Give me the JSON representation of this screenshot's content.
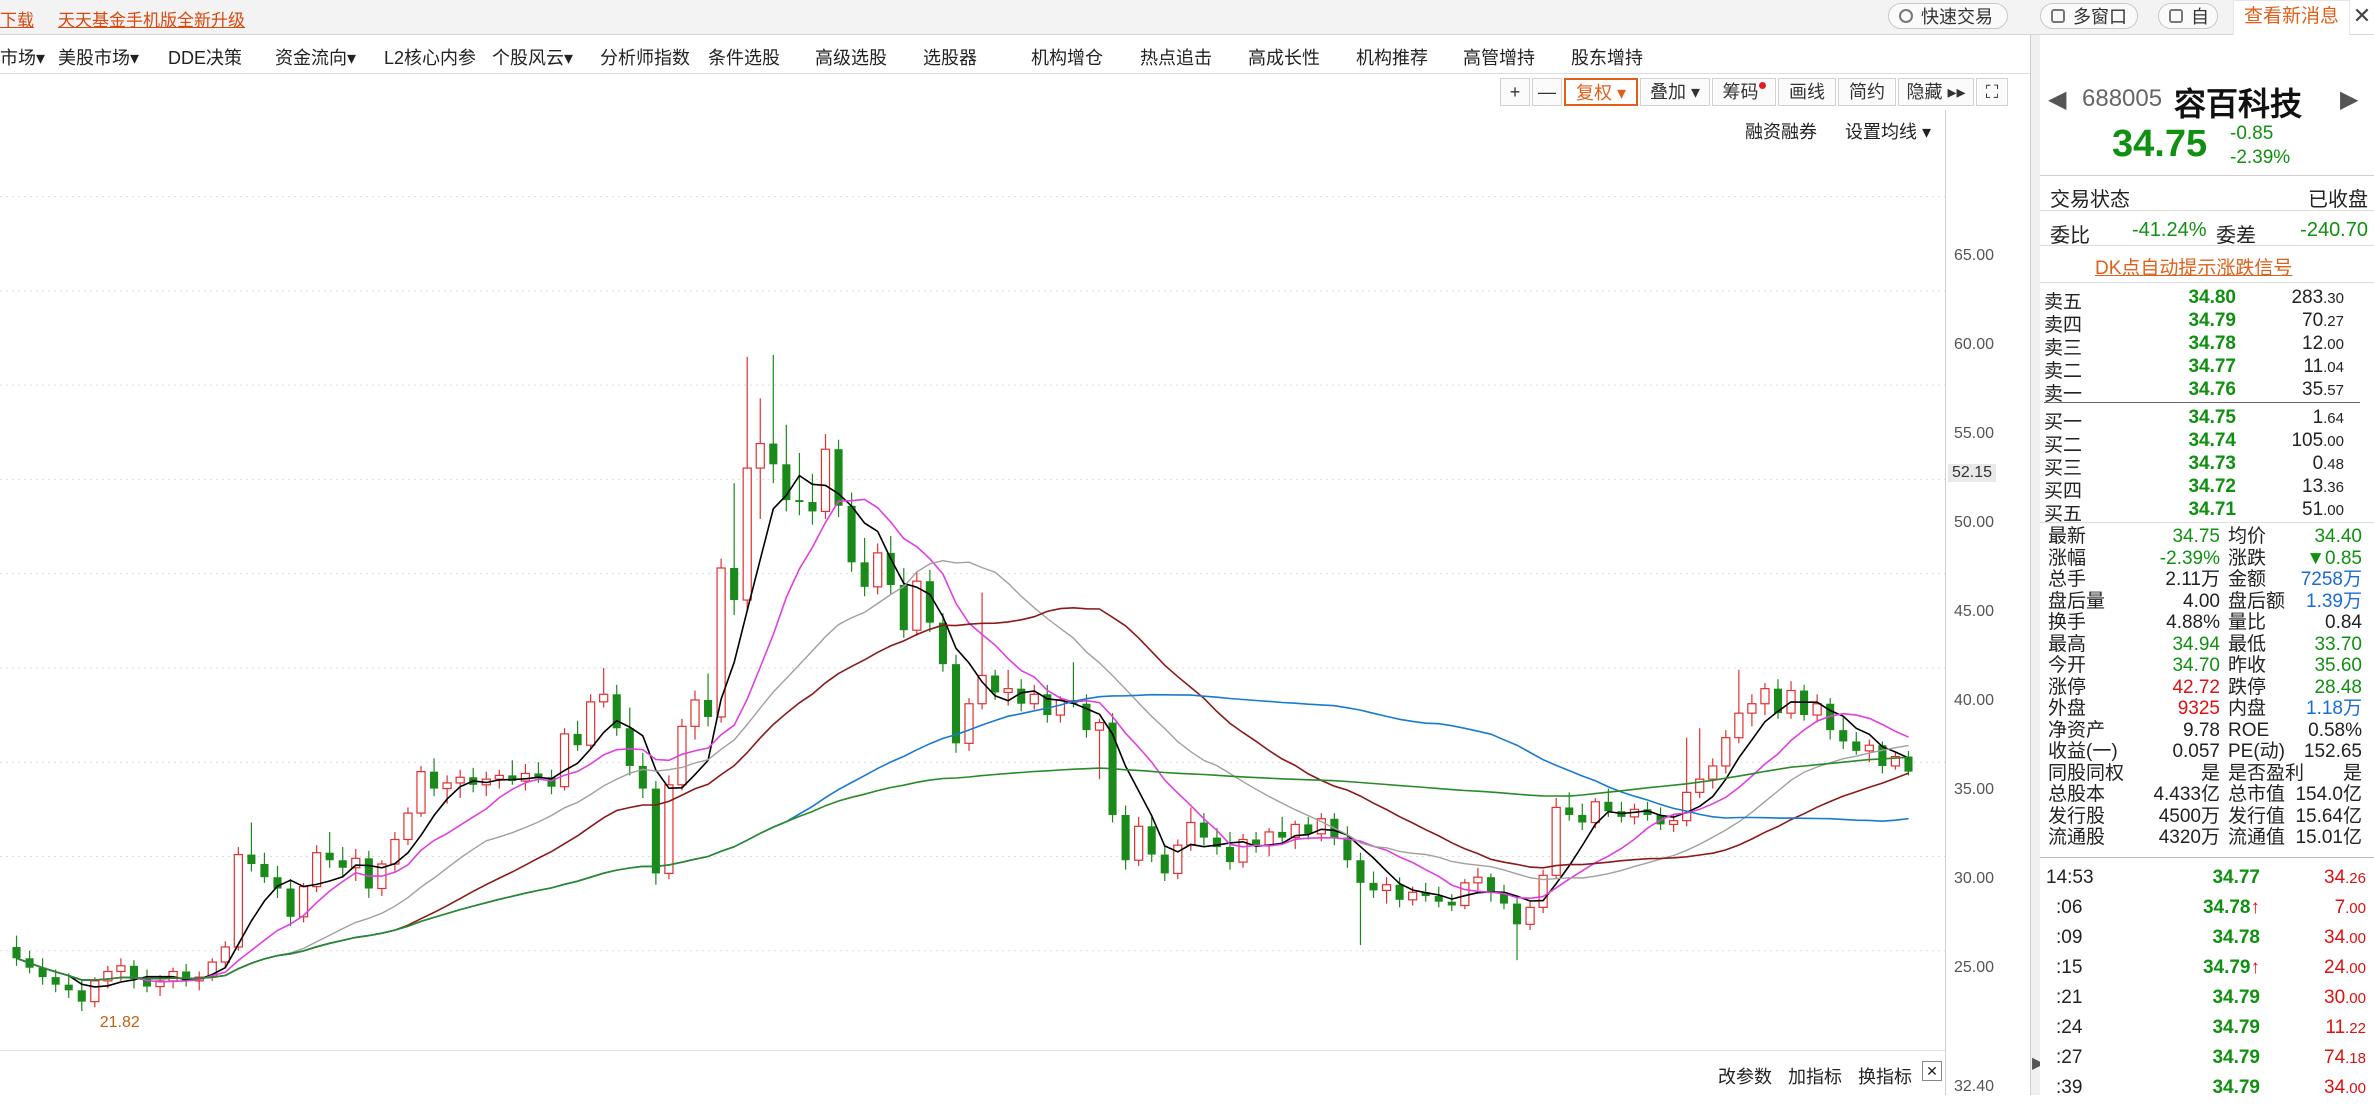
{
  "topbar": {
    "left_cut": "下载",
    "promo": "天天基金手机版全新升级",
    "quick_trade": "快速交易",
    "multi_window": "多窗口",
    "self_cut": "自选",
    "notify": "查看新消息",
    "close": "✕"
  },
  "menu": [
    "市场",
    "美股市场",
    "DDE决策",
    "资金流向",
    "L2核心内参",
    "个股风云",
    "分析师指数",
    "条件选股",
    "高级选股",
    "选股器",
    "机构增仓",
    "热点追击",
    "高成长性",
    "机构推荐",
    "高管增持",
    "股东增持"
  ],
  "toolbar": {
    "plus": "+",
    "minus": "—",
    "adjust": "复权",
    "overlay": "叠加",
    "chips": "筹码",
    "draw": "画线",
    "simple": "简约",
    "hide": "隐藏",
    "expand": "⛶"
  },
  "subtools": {
    "margin": "融资融券",
    "ma_setting": "设置均线"
  },
  "axis": {
    "ticks": [
      "65.00",
      "60.00",
      "55.00",
      "50.00",
      "45.00",
      "40.00",
      "35.00",
      "30.00",
      "25.00"
    ],
    "current_mark": "52.15",
    "bottom_value": "32.40"
  },
  "chart_data": {
    "type": "candlestick",
    "ylim": [
      20,
      68
    ],
    "low_annotation": "21.82",
    "candles": [
      [
        25.2,
        25.8,
        24.2,
        24.6
      ],
      [
        24.6,
        25.0,
        23.8,
        24.1
      ],
      [
        24.1,
        24.6,
        23.2,
        23.6
      ],
      [
        23.6,
        24.0,
        22.8,
        23.2
      ],
      [
        23.2,
        23.8,
        22.5,
        22.9
      ],
      [
        22.9,
        23.4,
        21.8,
        22.3
      ],
      [
        22.3,
        23.6,
        22.0,
        23.4
      ],
      [
        23.4,
        24.2,
        23.0,
        23.9
      ],
      [
        23.9,
        24.6,
        23.4,
        24.2
      ],
      [
        24.2,
        24.5,
        23.0,
        23.5
      ],
      [
        23.5,
        24.0,
        22.8,
        23.1
      ],
      [
        23.1,
        23.7,
        22.6,
        23.4
      ],
      [
        23.4,
        24.1,
        23.0,
        23.9
      ],
      [
        23.9,
        24.3,
        23.1,
        23.4
      ],
      [
        23.4,
        23.9,
        22.9,
        23.6
      ],
      [
        23.6,
        24.6,
        23.4,
        24.4
      ],
      [
        24.4,
        25.5,
        24.1,
        25.2
      ],
      [
        25.2,
        30.5,
        25.0,
        30.1
      ],
      [
        30.1,
        31.8,
        29.2,
        29.6
      ],
      [
        29.6,
        30.2,
        28.6,
        28.9
      ],
      [
        28.9,
        29.5,
        27.8,
        28.3
      ],
      [
        28.3,
        28.8,
        26.3,
        26.8
      ],
      [
        26.8,
        28.6,
        26.5,
        28.4
      ],
      [
        28.4,
        30.6,
        28.1,
        30.2
      ],
      [
        30.2,
        31.3,
        29.4,
        29.8
      ],
      [
        29.8,
        30.5,
        28.9,
        29.4
      ],
      [
        29.4,
        30.4,
        28.7,
        29.9
      ],
      [
        29.9,
        30.3,
        27.8,
        28.3
      ],
      [
        28.3,
        29.8,
        27.9,
        29.6
      ],
      [
        29.6,
        31.3,
        29.2,
        30.9
      ],
      [
        30.9,
        32.6,
        30.6,
        32.3
      ],
      [
        32.3,
        34.8,
        32.1,
        34.5
      ],
      [
        34.5,
        35.2,
        33.2,
        33.6
      ],
      [
        33.6,
        34.3,
        32.8,
        33.9
      ],
      [
        33.9,
        34.6,
        33.1,
        34.2
      ],
      [
        34.2,
        34.7,
        33.4,
        33.8
      ],
      [
        33.8,
        34.5,
        33.2,
        34.1
      ],
      [
        34.1,
        34.6,
        33.6,
        34.3
      ],
      [
        34.3,
        35.1,
        33.8,
        34.0
      ],
      [
        34.0,
        34.9,
        33.5,
        34.4
      ],
      [
        34.4,
        35.0,
        33.9,
        34.2
      ],
      [
        34.2,
        34.6,
        33.3,
        33.7
      ],
      [
        33.7,
        36.8,
        33.5,
        36.5
      ],
      [
        36.5,
        37.2,
        35.6,
        35.9
      ],
      [
        35.9,
        38.6,
        35.7,
        38.2
      ],
      [
        38.2,
        40.0,
        37.9,
        38.6
      ],
      [
        38.6,
        39.1,
        36.4,
        36.8
      ],
      [
        36.8,
        37.9,
        34.3,
        34.8
      ],
      [
        34.8,
        35.5,
        33.1,
        33.6
      ],
      [
        33.6,
        34.0,
        28.5,
        29.1
      ],
      [
        29.1,
        34.3,
        28.8,
        33.8
      ],
      [
        33.8,
        37.3,
        33.5,
        36.9
      ],
      [
        36.9,
        38.8,
        36.2,
        38.3
      ],
      [
        38.3,
        39.7,
        36.9,
        37.4
      ],
      [
        37.4,
        45.8,
        37.1,
        45.3
      ],
      [
        45.3,
        49.8,
        42.8,
        43.6
      ],
      [
        43.6,
        56.5,
        43.1,
        50.6
      ],
      [
        50.6,
        54.3,
        47.9,
        51.9
      ],
      [
        51.9,
        56.6,
        49.8,
        50.8
      ],
      [
        50.8,
        52.9,
        48.3,
        48.9
      ],
      [
        48.9,
        51.4,
        48.1,
        48.8
      ],
      [
        48.8,
        50.3,
        47.6,
        48.3
      ],
      [
        48.3,
        52.4,
        47.9,
        51.6
      ],
      [
        51.6,
        52.1,
        48.0,
        48.6
      ],
      [
        48.6,
        49.3,
        45.1,
        45.6
      ],
      [
        45.6,
        46.9,
        43.8,
        44.3
      ],
      [
        44.3,
        46.6,
        43.9,
        46.1
      ],
      [
        46.1,
        47.0,
        43.9,
        44.4
      ],
      [
        44.4,
        45.3,
        41.6,
        42.0
      ],
      [
        42.0,
        45.1,
        41.7,
        44.6
      ],
      [
        44.6,
        45.2,
        41.9,
        42.4
      ],
      [
        42.4,
        42.9,
        39.8,
        40.2
      ],
      [
        40.2,
        40.7,
        35.5,
        36.0
      ],
      [
        36.0,
        38.4,
        35.6,
        38.1
      ],
      [
        38.1,
        44.0,
        37.8,
        39.6
      ],
      [
        39.6,
        39.9,
        38.3,
        38.7
      ],
      [
        38.7,
        39.9,
        38.0,
        38.9
      ],
      [
        38.9,
        39.4,
        37.7,
        38.1
      ],
      [
        38.1,
        39.1,
        37.8,
        38.6
      ],
      [
        38.6,
        39.1,
        37.1,
        37.5
      ],
      [
        37.5,
        38.5,
        37.1,
        38.3
      ],
      [
        38.3,
        40.3,
        37.9,
        38.1
      ],
      [
        38.1,
        38.6,
        36.3,
        36.7
      ],
      [
        36.7,
        37.3,
        34.1,
        37.1
      ],
      [
        37.1,
        37.6,
        31.8,
        32.2
      ],
      [
        32.2,
        32.7,
        29.3,
        29.8
      ],
      [
        29.8,
        32.1,
        29.5,
        31.6
      ],
      [
        31.6,
        32.1,
        29.7,
        30.1
      ],
      [
        30.1,
        30.6,
        28.7,
        29.1
      ],
      [
        29.1,
        30.9,
        28.8,
        30.6
      ],
      [
        30.6,
        32.6,
        30.3,
        31.8
      ],
      [
        31.8,
        32.3,
        30.6,
        31.0
      ],
      [
        31.0,
        31.5,
        30.1,
        30.5
      ],
      [
        30.5,
        31.3,
        29.3,
        29.7
      ],
      [
        29.7,
        31.2,
        29.4,
        30.9
      ],
      [
        30.9,
        31.3,
        30.2,
        30.6
      ],
      [
        30.6,
        31.5,
        30.0,
        31.3
      ],
      [
        31.3,
        32.1,
        30.7,
        31.0
      ],
      [
        31.0,
        31.9,
        30.4,
        31.7
      ],
      [
        31.7,
        32.1,
        30.9,
        31.2
      ],
      [
        31.2,
        32.3,
        30.8,
        32.0
      ],
      [
        32.0,
        32.3,
        30.6,
        31.0
      ],
      [
        31.0,
        31.6,
        29.4,
        29.8
      ],
      [
        29.8,
        30.2,
        25.3,
        28.6
      ],
      [
        28.6,
        29.2,
        27.8,
        28.2
      ],
      [
        28.2,
        28.9,
        27.5,
        28.5
      ],
      [
        28.5,
        28.9,
        27.3,
        27.7
      ],
      [
        27.7,
        28.4,
        27.4,
        28.1
      ],
      [
        28.1,
        28.6,
        27.6,
        27.9
      ],
      [
        27.9,
        28.4,
        27.3,
        27.6
      ],
      [
        27.6,
        28.0,
        27.1,
        27.4
      ],
      [
        27.4,
        28.8,
        27.2,
        28.6
      ],
      [
        28.6,
        29.4,
        28.2,
        28.9
      ],
      [
        28.9,
        29.1,
        27.6,
        28.1
      ],
      [
        28.1,
        28.5,
        27.2,
        27.5
      ],
      [
        27.5,
        27.9,
        24.5,
        26.4
      ],
      [
        26.4,
        27.6,
        26.1,
        27.3
      ],
      [
        27.3,
        29.3,
        27.0,
        29.0
      ],
      [
        29.0,
        33.1,
        28.8,
        32.6
      ],
      [
        32.6,
        33.4,
        31.9,
        32.2
      ],
      [
        32.2,
        32.8,
        31.4,
        31.8
      ],
      [
        31.8,
        33.1,
        31.5,
        32.9
      ],
      [
        32.9,
        33.6,
        32.1,
        32.4
      ],
      [
        32.4,
        32.9,
        31.8,
        32.1
      ],
      [
        32.1,
        32.8,
        31.7,
        32.5
      ],
      [
        32.5,
        32.9,
        31.9,
        32.2
      ],
      [
        32.2,
        32.6,
        31.4,
        31.7
      ],
      [
        31.7,
        32.2,
        31.3,
        31.9
      ],
      [
        31.9,
        36.3,
        31.6,
        33.4
      ],
      [
        33.4,
        36.8,
        33.1,
        34.1
      ],
      [
        34.1,
        35.2,
        33.6,
        34.8
      ],
      [
        34.8,
        36.7,
        34.4,
        36.3
      ],
      [
        36.3,
        39.9,
        36.0,
        37.6
      ],
      [
        37.6,
        38.6,
        36.9,
        38.1
      ],
      [
        38.1,
        39.2,
        37.5,
        38.9
      ],
      [
        38.9,
        39.4,
        37.3,
        37.6
      ],
      [
        37.6,
        39.3,
        37.3,
        38.8
      ],
      [
        38.8,
        39.1,
        37.2,
        37.5
      ],
      [
        37.5,
        38.6,
        37.1,
        38.1
      ],
      [
        38.1,
        38.4,
        36.2,
        36.7
      ],
      [
        36.7,
        37.4,
        35.7,
        36.1
      ],
      [
        36.1,
        36.6,
        35.4,
        35.6
      ],
      [
        35.6,
        36.2,
        35.0,
        35.9
      ],
      [
        35.9,
        36.1,
        34.4,
        34.8
      ],
      [
        34.8,
        35.5,
        34.6,
        35.3
      ],
      [
        35.3,
        35.6,
        34.3,
        34.5
      ]
    ]
  },
  "right_panel": {
    "code": "688005",
    "name": "容百科技",
    "price": "34.75",
    "change": "-0.85",
    "change_pct": "-2.39%",
    "status_label": "交易状态",
    "status_value": "已收盘",
    "ratio_label": "委比",
    "ratio_value": "-41.24%",
    "diff_label": "委差",
    "diff_value": "-240.70",
    "dk_link": "DK点自动提示涨跌信号",
    "asks": [
      {
        "label": "卖五",
        "price": "34.80",
        "vol": "283",
        "dec": "30"
      },
      {
        "label": "卖四",
        "price": "34.79",
        "vol": "70",
        "dec": "27"
      },
      {
        "label": "卖三",
        "price": "34.78",
        "vol": "12",
        "dec": "00"
      },
      {
        "label": "卖二",
        "price": "34.77",
        "vol": "11",
        "dec": "04"
      },
      {
        "label": "卖一",
        "price": "34.76",
        "vol": "35",
        "dec": "57"
      }
    ],
    "bids": [
      {
        "label": "买一",
        "price": "34.75",
        "vol": "1",
        "dec": "64"
      },
      {
        "label": "买二",
        "price": "34.74",
        "vol": "105",
        "dec": "00"
      },
      {
        "label": "买三",
        "price": "34.73",
        "vol": "0",
        "dec": "48"
      },
      {
        "label": "买四",
        "price": "34.72",
        "vol": "13",
        "dec": "36"
      },
      {
        "label": "买五",
        "price": "34.71",
        "vol": "51",
        "dec": "00"
      }
    ],
    "stats": [
      [
        "最新",
        "34.75",
        "均价",
        "34.40"
      ],
      [
        "涨幅",
        "-2.39%",
        "涨跌",
        "▼0.85"
      ],
      [
        "总手",
        "2.11万",
        "金额",
        "7258万"
      ],
      [
        "盘后量",
        "4.00",
        "盘后额",
        "1.39万"
      ],
      [
        "换手",
        "4.88%",
        "量比",
        "0.84"
      ],
      [
        "最高",
        "34.94",
        "最低",
        "33.70"
      ],
      [
        "今开",
        "34.70",
        "昨收",
        "35.60"
      ],
      [
        "涨停",
        "42.72",
        "跌停",
        "28.48"
      ],
      [
        "外盘",
        "9325",
        "内盘",
        "1.18万"
      ],
      [
        "净资产",
        "9.78",
        "ROE",
        "0.58%"
      ],
      [
        "收益(一)",
        "0.057",
        "PE(动)",
        "152.65"
      ],
      [
        "同股同权",
        "是",
        "是否盈利",
        "是"
      ],
      [
        "总股本",
        "4.433亿",
        "总市值",
        "154.0亿"
      ],
      [
        "发行股",
        "4500万",
        "发行值",
        "15.64亿"
      ],
      [
        "流通股",
        "4320万",
        "流通值",
        "15.01亿"
      ]
    ],
    "ticks": [
      {
        "time": "14:53",
        "price": "34.77",
        "arrow": "",
        "vol": "34",
        "dec": "26"
      },
      {
        "time": ":06",
        "price": "34.78",
        "arrow": "↑",
        "vol": "7",
        "dec": "00"
      },
      {
        "time": ":09",
        "price": "34.78",
        "arrow": "",
        "vol": "34",
        "dec": "00"
      },
      {
        "time": ":15",
        "price": "34.79",
        "arrow": "↑",
        "vol": "24",
        "dec": "00"
      },
      {
        "time": ":21",
        "price": "34.79",
        "arrow": "",
        "vol": "30",
        "dec": "00"
      },
      {
        "time": ":24",
        "price": "34.79",
        "arrow": "",
        "vol": "11",
        "dec": "22"
      },
      {
        "time": ":27",
        "price": "34.79",
        "arrow": "",
        "vol": "74",
        "dec": "18"
      },
      {
        "time": ":39",
        "price": "34.79",
        "arrow": "",
        "vol": "34",
        "dec": "00"
      }
    ]
  },
  "bottom": {
    "params": "改参数",
    "add_indicator": "加指标",
    "switch_indicator": "换指标",
    "close": "✕"
  },
  "colors": {
    "up": "#e03030",
    "down": "#1a8a1a",
    "ma5": "#000000",
    "ma10": "#e040e0",
    "ma20": "#a0a0a0",
    "ma30": "#8b1a1a",
    "ma60": "#1a7ad0",
    "ma120": "#2a8a2a"
  }
}
